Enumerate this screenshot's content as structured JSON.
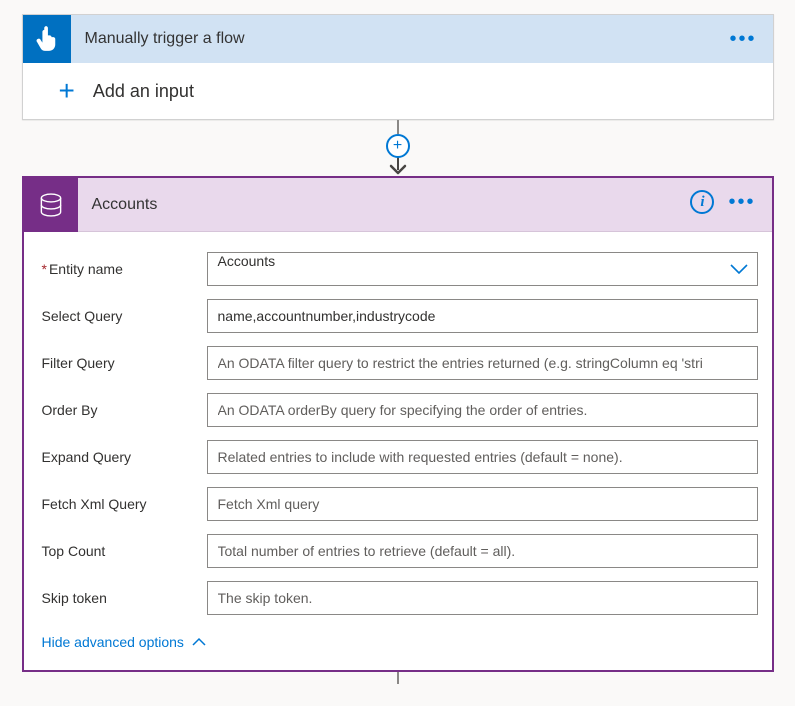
{
  "trigger": {
    "title": "Manually trigger a flow",
    "add_input_label": "Add an input"
  },
  "action": {
    "title": "Accounts",
    "hide_advanced_label": "Hide advanced options",
    "fields": {
      "entity_name": {
        "label": "Entity name",
        "value": "Accounts",
        "required": true
      },
      "select_query": {
        "label": "Select Query",
        "value": "name,accountnumber,industrycode",
        "placeholder": ""
      },
      "filter_query": {
        "label": "Filter Query",
        "value": "",
        "placeholder": "An ODATA filter query to restrict the entries returned (e.g. stringColumn eq 'stri"
      },
      "order_by": {
        "label": "Order By",
        "value": "",
        "placeholder": "An ODATA orderBy query for specifying the order of entries."
      },
      "expand_query": {
        "label": "Expand Query",
        "value": "",
        "placeholder": "Related entries to include with requested entries (default = none)."
      },
      "fetch_xml_query": {
        "label": "Fetch Xml Query",
        "value": "",
        "placeholder": "Fetch Xml query"
      },
      "top_count": {
        "label": "Top Count",
        "value": "",
        "placeholder": "Total number of entries to retrieve (default = all)."
      },
      "skip_token": {
        "label": "Skip token",
        "value": "",
        "placeholder": "The skip token."
      }
    }
  },
  "colors": {
    "accent_blue": "#0078d4",
    "trigger_blue": "#0070c1",
    "trigger_header_bg": "#d1e2f3",
    "action_purple": "#762e87",
    "action_header_bg": "#e9d9ec"
  }
}
